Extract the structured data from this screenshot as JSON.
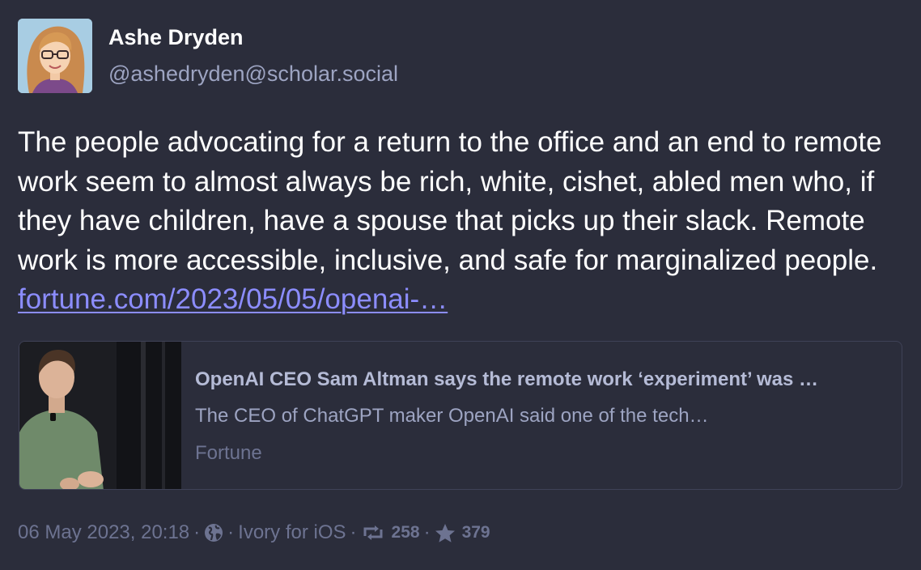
{
  "author": {
    "display_name": "Ashe Dryden",
    "handle": "@ashedryden@scholar.social",
    "avatar_icon": "avatar-illustration"
  },
  "post": {
    "text": "The people advocating for a return to the office and an end to remote work seem to almost always be rich, white, cishet, abled men who, if they have children, have a spouse that picks up their slack. Remote work is more accessible, inclusive, and safe for marginalized people.",
    "link_text": "fortune.com/2023/05/05/openai-…"
  },
  "link_card": {
    "title": "OpenAI CEO Sam Altman says the remote work ‘experiment’ was …",
    "description": "The CEO of ChatGPT maker OpenAI said one of the tech…",
    "source": "Fortune"
  },
  "meta": {
    "timestamp": "06 May 2023, 20:18",
    "separator": "·",
    "visibility_icon": "globe-icon",
    "client": "Ivory for iOS",
    "boost_count": "258",
    "favourite_count": "379"
  },
  "colors": {
    "background": "#2b2d3b",
    "link": "#8c8dff",
    "muted": "#6d7391"
  }
}
